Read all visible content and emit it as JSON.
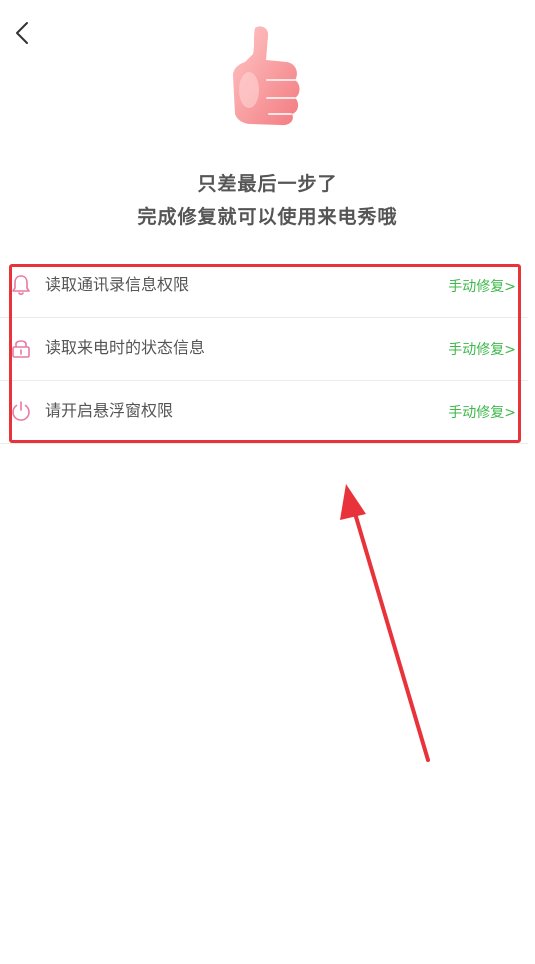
{
  "header": {
    "back_icon": "chevron-left-icon"
  },
  "hero": {
    "icon": "thumbs-up-icon"
  },
  "headline": {
    "line1": "只差最后一步了",
    "line2": "完成修复就可以使用来电秀哦"
  },
  "permissions": [
    {
      "icon": "bell-icon",
      "label": "读取通讯录信息权限",
      "action": "手动修复>"
    },
    {
      "icon": "lock-icon",
      "label": "读取来电时的状态信息",
      "action": "手动修复>"
    },
    {
      "icon": "power-icon",
      "label": "请开启悬浮窗权限",
      "action": "手动修复>"
    }
  ],
  "colors": {
    "accent_green": "#3db84a",
    "annotation_red": "#e8333b",
    "icon_pink": "#e87aa3"
  }
}
